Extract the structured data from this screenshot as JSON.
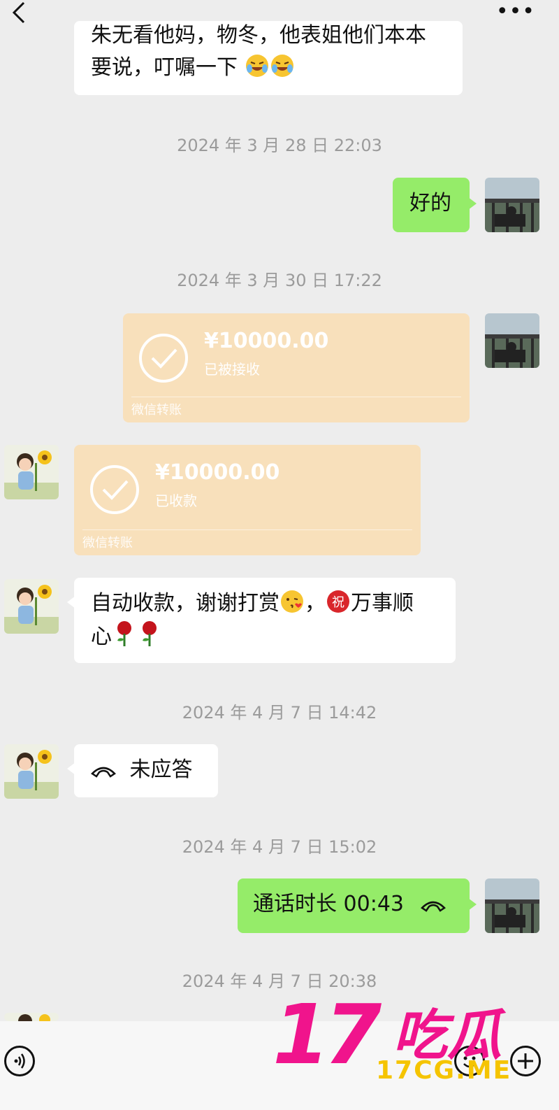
{
  "header": {
    "back_icon": "chevron-left-icon",
    "more_label": "•••"
  },
  "messages": {
    "m1": {
      "text_line1": "朱无看他妈，物冬，他表姐他们本本",
      "text_line2": "要说，叮嘱一下"
    },
    "ts1": "2024 年 3 月 28 日 22:03",
    "m2": {
      "text": "好的"
    },
    "ts2": "2024 年 3 月 30 日 17:22",
    "transfer1": {
      "amount": "¥10000.00",
      "status": "已被接收",
      "foot": "微信转账"
    },
    "transfer2": {
      "amount": "¥10000.00",
      "status": "已收款",
      "foot": "微信转账"
    },
    "m3": {
      "text_a": "自动收款，谢谢打赏",
      "text_b": "，",
      "text_c": "万事顺",
      "text_line2": "心"
    },
    "ts3": "2024 年 4 月 7 日 14:42",
    "call1": {
      "text": "未应答"
    },
    "ts4": "2024 年 4 月 7 日 15:02",
    "call2": {
      "text": "通话时长 00:43"
    },
    "ts5": "2024 年 4 月 7 日 20:38"
  },
  "watermark": {
    "number": "17",
    "chinese": "吃瓜",
    "domain": "17CG.ME"
  },
  "colors": {
    "background": "#ededed",
    "self_bubble": "#95ec69",
    "transfer": "#f8e0bb",
    "timestamp": "#9b9b9b",
    "watermark_pink": "#f0148c",
    "watermark_yellow": "#f5c400"
  }
}
